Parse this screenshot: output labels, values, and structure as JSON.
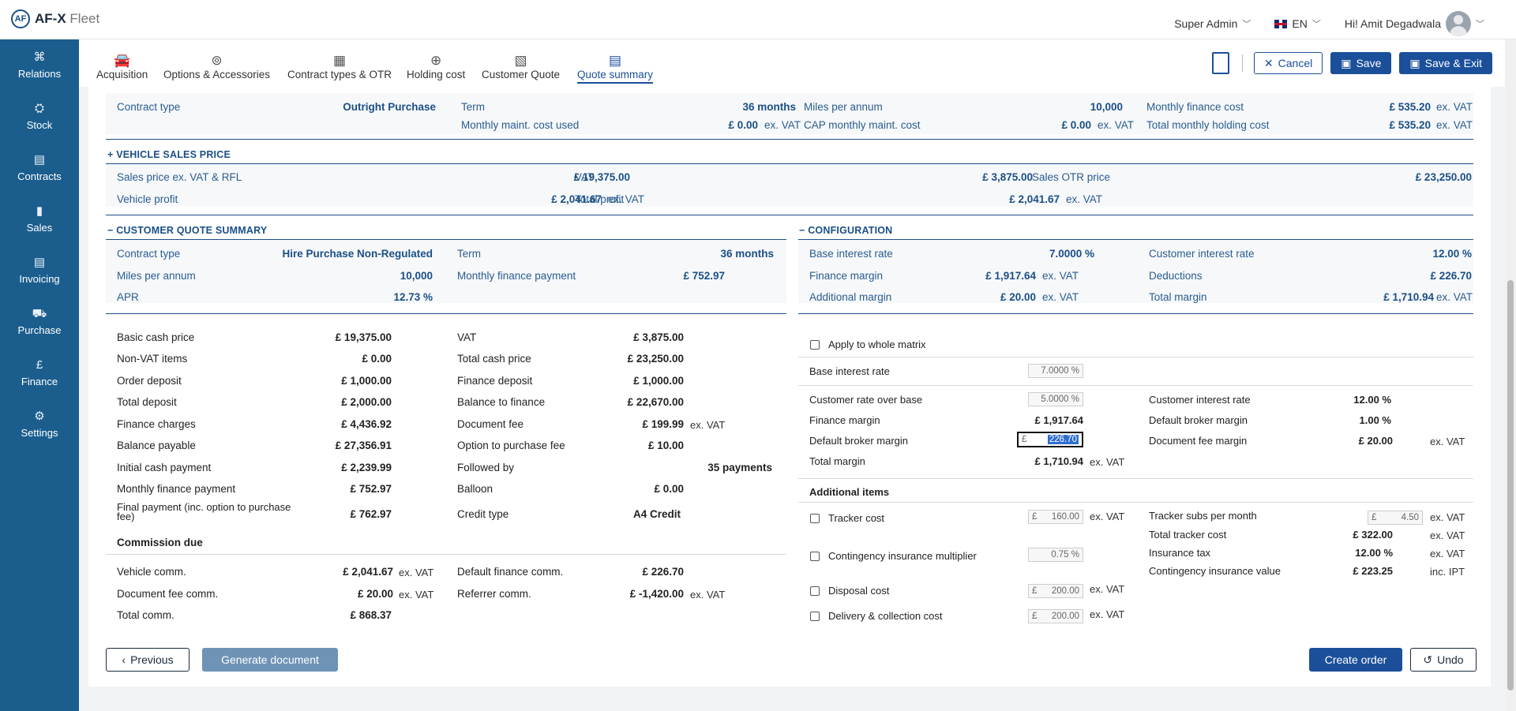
{
  "app": {
    "logo_mark": "AF",
    "name_bold": "AF-X",
    "name_rest": "Fleet"
  },
  "topbar": {
    "role": "Super Admin",
    "language": "EN",
    "greeting": "Hi! Amit Degadwala"
  },
  "sidebar": {
    "items": [
      {
        "label": "Relations",
        "icon": "relations-icon"
      },
      {
        "label": "Stock",
        "icon": "stock-icon"
      },
      {
        "label": "Contracts",
        "icon": "contracts-icon"
      },
      {
        "label": "Sales",
        "icon": "sales-icon"
      },
      {
        "label": "Invoicing",
        "icon": "invoicing-icon"
      },
      {
        "label": "Purchase",
        "icon": "cart-icon"
      },
      {
        "label": "Finance",
        "icon": "pound-icon",
        "glyph": "£"
      },
      {
        "label": "Settings",
        "icon": "gear-icon"
      }
    ]
  },
  "tabs": [
    {
      "label": "Acquisition"
    },
    {
      "label": "Options & Accessories"
    },
    {
      "label": "Contract types & OTR"
    },
    {
      "label": "Holding cost"
    },
    {
      "label": "Customer Quote"
    },
    {
      "label": "Quote summary",
      "active": true
    }
  ],
  "toolbar": {
    "cancel": "Cancel",
    "save": "Save",
    "save_exit": "Save & Exit"
  },
  "holding": {
    "contract_type_label": "Contract type",
    "contract_type_value": "Outright Purchase",
    "term_label": "Term",
    "term_value": "36 months",
    "miles_label": "Miles per annum",
    "miles_value": "10,000",
    "monthly_finance_label": "Monthly finance cost",
    "monthly_finance_value": "£ 535.20",
    "maint_used_label": "Monthly maint. cost used",
    "maint_used_value": "£ 0.00",
    "cap_maint_label": "CAP monthly maint. cost",
    "cap_maint_value": "£ 0.00",
    "total_holding_label": "Total monthly holding cost",
    "total_holding_value": "£ 535.20",
    "unit_exvat": "ex. VAT"
  },
  "vehicle_sales": {
    "title": "VEHICLE SALES PRICE",
    "toggle": "+",
    "sales_price_label": "Sales price ex. VAT & RFL",
    "sales_price_value": "£ 19,375.00",
    "vat_label": "VAT",
    "vat_value": "£ 3,875.00",
    "otr_label": "Sales OTR price",
    "otr_value": "£ 23,250.00",
    "vehicle_profit_label": "Vehicle profit",
    "vehicle_profit_value": "£ 2,041.67",
    "total_profit_label": "Total profit",
    "total_profit_value": "£ 2,041.67"
  },
  "customer_quote": {
    "title": "CUSTOMER QUOTE SUMMARY",
    "toggle": "−",
    "contract_type_label": "Contract type",
    "contract_type_value": "Hire Purchase Non-Regulated",
    "term_label": "Term",
    "term_value": "36 months",
    "miles_label": "Miles per annum",
    "miles_value": "10,000",
    "mfp_label": "Monthly finance payment",
    "mfp_value": "£ 752.97",
    "apr_label": "APR",
    "apr_value": "12.73 %"
  },
  "configuration": {
    "title": "CONFIGURATION",
    "toggle": "−",
    "base_label": "Base interest rate",
    "base_value": "7.0000 %",
    "cust_label": "Customer interest rate",
    "cust_value": "12.00 %",
    "fm_label": "Finance margin",
    "fm_value": "£ 1,917.64",
    "ded_label": "Deductions",
    "ded_value": "£ 226.70",
    "add_label": "Additional margin",
    "add_value": "£ 20.00",
    "tm_label": "Total margin",
    "tm_value": "£ 1,710.94"
  },
  "details": {
    "left": [
      {
        "label": "Basic cash price",
        "value": "£ 19,375.00"
      },
      {
        "label": "Non-VAT items",
        "value": "£ 0.00"
      },
      {
        "label": "Order deposit",
        "value": "£ 1,000.00"
      },
      {
        "label": "Total deposit",
        "value": "£ 2,000.00"
      },
      {
        "label": "Finance charges",
        "value": "£ 4,436.92"
      },
      {
        "label": "Balance payable",
        "value": "£ 27,356.91"
      },
      {
        "label": "Initial cash payment",
        "value": "£ 2,239.99"
      },
      {
        "label": "Monthly finance payment",
        "value": "£ 752.97"
      }
    ],
    "final_payment_label_1": "Final payment (inc. option to purchase",
    "final_payment_label_2": "fee)",
    "final_payment_value": "£ 762.97",
    "right": [
      {
        "label": "VAT",
        "value": "£ 3,875.00"
      },
      {
        "label": "Total cash price",
        "value": "£ 23,250.00"
      },
      {
        "label": "Finance deposit",
        "value": "£ 1,000.00"
      },
      {
        "label": "Balance to finance",
        "value": "£ 22,670.00"
      },
      {
        "label": "Document fee",
        "value": "£ 199.99",
        "unit": "ex. VAT"
      },
      {
        "label": "Option to purchase fee",
        "value": "£ 10.00"
      },
      {
        "label": "Followed by",
        "value": "35 payments"
      },
      {
        "label": "Balloon",
        "value": "£ 0.00"
      }
    ],
    "credit_label": "Credit type",
    "credit_value": "A4 Credit"
  },
  "commission": {
    "title": "Commission due",
    "vehicle_label": "Vehicle comm.",
    "vehicle_value": "£ 2,041.67",
    "docfee_label": "Document fee comm.",
    "docfee_value": "£ 20.00",
    "total_label": "Total comm.",
    "total_value": "£ 868.37",
    "def_finance_label": "Default finance comm.",
    "def_finance_value": "£ 226.70",
    "referrer_label": "Referrer comm.",
    "referrer_value": "£ -1,420.00",
    "unit": "ex. VAT"
  },
  "config_form": {
    "apply_label": "Apply to whole matrix",
    "base_label": "Base interest rate",
    "base_input": "7.0000 %",
    "crob_label": "Customer rate over base",
    "crob_input": "5.0000 %",
    "fm_label": "Finance margin",
    "fm_value": "£ 1,917.64",
    "dbm_label": "Default broker margin",
    "dbm_currency": "£",
    "dbm_input": "226.70",
    "tm_label": "Total margin",
    "tm_value": "£ 1,710.94",
    "tm_unit": "ex. VAT",
    "cir_label": "Customer interest rate",
    "cir_value": "12.00 %",
    "dbm2_label": "Default broker margin",
    "dbm2_value": "1.00 %",
    "dfm_label": "Document fee margin",
    "dfm_value": "£ 20.00",
    "dfm_unit": "ex. VAT"
  },
  "additional": {
    "title": "Additional items",
    "tracker_label": "Tracker cost",
    "tracker_input": "160.00",
    "contingency_label": "Contingency insurance multiplier",
    "contingency_input": "0.75 %",
    "disposal_label": "Disposal cost",
    "disposal_input": "200.00",
    "delivery_label": "Delivery & collection cost",
    "delivery_input": "200.00",
    "currency": "£",
    "unit": "ex. VAT",
    "subs_label": "Tracker subs per month",
    "subs_input": "4.50",
    "total_tracker_label": "Total tracker cost",
    "total_tracker_value": "£ 322.00",
    "ins_tax_label": "Insurance tax",
    "ins_tax_value": "12.00 %",
    "civ_label": "Contingency insurance value",
    "civ_value": "£ 223.25",
    "civ_unit": "inc. IPT"
  },
  "footer": {
    "previous": "Previous",
    "generate": "Generate document",
    "create_order": "Create order",
    "undo": "Undo"
  }
}
